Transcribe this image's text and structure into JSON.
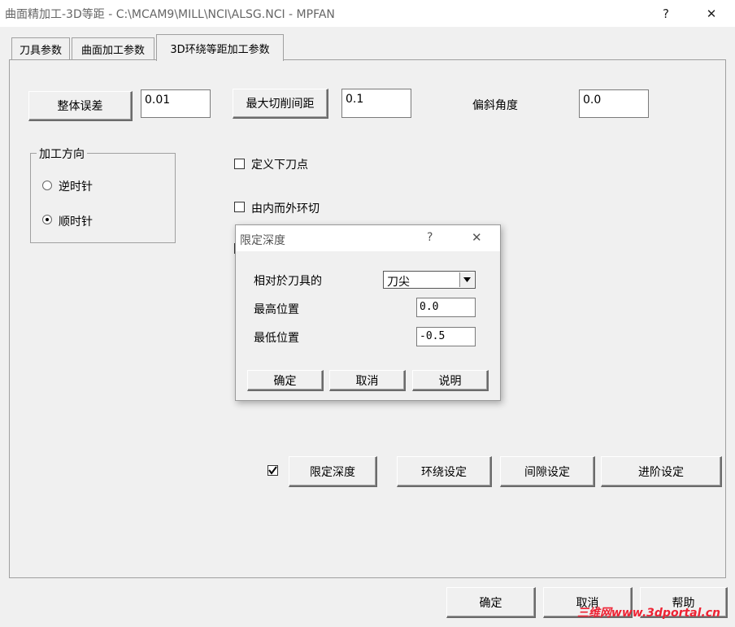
{
  "window": {
    "title": "曲面精加工-3D等距 - C:\\MCAM9\\MILL\\NCI\\ALSG.NCI - MPFAN",
    "help_glyph": "?",
    "close_glyph": "✕"
  },
  "tabs": [
    {
      "label": "刀具参数"
    },
    {
      "label": "曲面加工参数"
    },
    {
      "label": "3D环绕等距加工参数"
    }
  ],
  "params": {
    "total_error_button": "整体误差",
    "total_error_value": "0.01",
    "max_stepover_button": "最大切削间距",
    "max_stepover_value": "0.1",
    "tilt_angle_label": "偏斜角度",
    "tilt_angle_value": "0.0"
  },
  "direction_group": {
    "title": "加工方向",
    "ccw_label": "逆时针",
    "cw_label": "顺时针",
    "selected": "cw"
  },
  "options": {
    "define_entry_label": "定义下刀点",
    "inside_out_label": "由内而外环切"
  },
  "bottom_buttons": {
    "limit_depth": "限定深度",
    "loop_settings": "环绕设定",
    "gap_settings": "间隙设定",
    "advanced_settings": "进阶设定"
  },
  "dialog": {
    "title": "限定深度",
    "help_glyph": "?",
    "close_glyph": "✕",
    "relative_label": "相对於刀具的",
    "relative_value": "刀尖",
    "max_label": "最高位置",
    "max_value": "0.0",
    "min_label": "最低位置",
    "min_value": "-0.5",
    "ok": "确定",
    "cancel": "取消",
    "help": "说明"
  },
  "footer": {
    "ok": "确定",
    "cancel": "取消",
    "help": "帮助"
  },
  "watermark": "三维网www.3dportal.cn"
}
